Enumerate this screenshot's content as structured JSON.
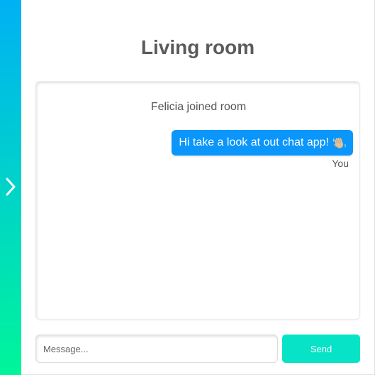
{
  "room": {
    "title": "Living room"
  },
  "sidebar": {
    "toggle_icon": "chevron-right-icon",
    "gradient_top": "#00b1f4",
    "gradient_bottom": "#00f59a"
  },
  "chat": {
    "system_message": "Felicia joined room",
    "messages": [
      {
        "text": "Hi take a look at out chat app!",
        "emoji": "waving-hand-icon",
        "author": "You",
        "bubble_color": "#0a96fb"
      }
    ]
  },
  "composer": {
    "placeholder": "Message...",
    "value": "",
    "send_label": "Send",
    "send_color": "#06e3c6"
  }
}
